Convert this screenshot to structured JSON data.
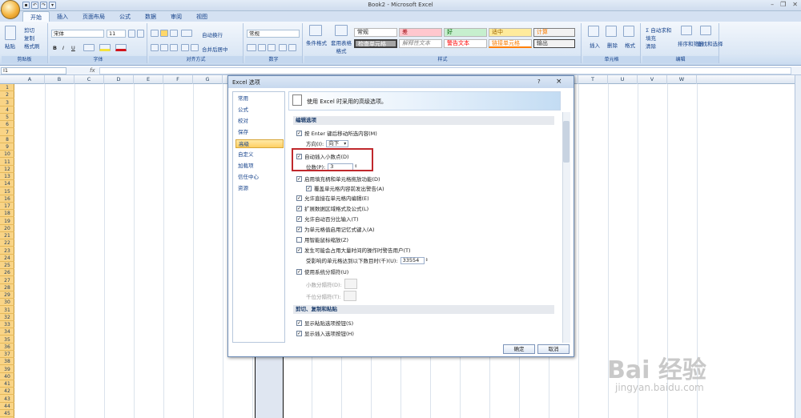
{
  "window": {
    "title": "Book2 - Microsoft Excel"
  },
  "tabs": [
    "开始",
    "插入",
    "页面布局",
    "公式",
    "数据",
    "审阅",
    "视图"
  ],
  "ribbon": {
    "clipboard": {
      "paste": "粘贴",
      "cut": "剪切",
      "copy": "复制",
      "format_painter": "格式刷",
      "label": "剪贴板"
    },
    "font": {
      "name": "宋体",
      "size": "11",
      "label": "字体",
      "bold": "B",
      "italic": "I",
      "underline": "U"
    },
    "alignment": {
      "wrap": "自动换行",
      "merge": "合并后居中",
      "label": "对齐方式"
    },
    "number": {
      "format": "常规",
      "label": "数字"
    },
    "styles": {
      "conditional": "条件格式",
      "table": "套用表格格式",
      "cells": [
        "常规",
        "差",
        "好",
        "适中",
        "计算",
        "检查单元格",
        "解释性文本",
        "警告文本",
        "链接单元格",
        "输出"
      ],
      "label": "样式"
    },
    "cells_group": {
      "insert": "插入",
      "delete": "删除",
      "format": "格式",
      "label": "单元格"
    },
    "editing": {
      "autosum": "自动求和",
      "fill": "填充",
      "clear": "清除",
      "sort": "排序和筛选",
      "find": "查找和选择",
      "label": "编辑"
    }
  },
  "formula_bar": {
    "name_box": "I1",
    "fx": "fx"
  },
  "columns": [
    "A",
    "B",
    "C",
    "D",
    "E",
    "F",
    "G",
    "H",
    "I",
    "J",
    "K",
    "L",
    "M",
    "N",
    "O",
    "P",
    "Q",
    "R",
    "S",
    "T",
    "U",
    "V",
    "W"
  ],
  "rows": [
    "1",
    "2",
    "3",
    "4",
    "5",
    "6",
    "7",
    "8",
    "9",
    "10",
    "11",
    "12",
    "13",
    "14",
    "15",
    "16",
    "17",
    "18",
    "19",
    "20",
    "21",
    "22",
    "23",
    "24",
    "25",
    "26",
    "27",
    "28",
    "29",
    "30",
    "31",
    "32",
    "33",
    "34",
    "35",
    "36",
    "37",
    "38",
    "39",
    "40",
    "41",
    "42",
    "43",
    "44",
    "45"
  ],
  "dialog": {
    "title": "Excel 选项",
    "help": "?",
    "close": "×",
    "nav": [
      "常用",
      "公式",
      "校对",
      "保存",
      "高级",
      "自定义",
      "加载项",
      "信任中心",
      "资源"
    ],
    "active_nav": "高级",
    "header": "使用 Excel 时采用的高级选项。",
    "sections": {
      "edit": "编辑选项",
      "clipboard": "剪切、复制和粘贴"
    },
    "options": {
      "enter_move": "按 Enter 键后移动所选内容(M)",
      "direction_label": "方向(I):",
      "direction_value": "向下",
      "auto_decimal": "自动插入小数点(D)",
      "places_label": "位数(P):",
      "places_value": "3",
      "fill_handle": "启用填充柄和单元格拖放功能(D)",
      "overwrite_alert": "覆盖单元格内容前发出警告(A)",
      "edit_in_cell": "允许直接在单元格内编辑(E)",
      "extend_formats": "扩展数据区域格式及公式(L)",
      "auto_percent": "允许自动百分比输入(T)",
      "autocomplete": "为单元格值启用记忆式键入(A)",
      "zoom_roll": "用智能鼠标缩放(Z)",
      "alert_slow": "发生可能会占用大量时间的操作时警告用户(T)",
      "cells_threshold_label": "受影响的单元格达到以下数目时(千)(U):",
      "cells_threshold_value": "33554",
      "system_sep": "使用系统分隔符(U)",
      "decimal_sep": "小数分隔符(D):",
      "thousands_sep": "千位分隔符(T):",
      "show_paste": "显示粘贴选项按钮(S)",
      "show_insert": "显示插入选项按钮(H)"
    },
    "ok": "确定",
    "cancel": "取消"
  },
  "watermark": {
    "main": "Bai 经验",
    "sub": "jingyan.baidu.com"
  }
}
